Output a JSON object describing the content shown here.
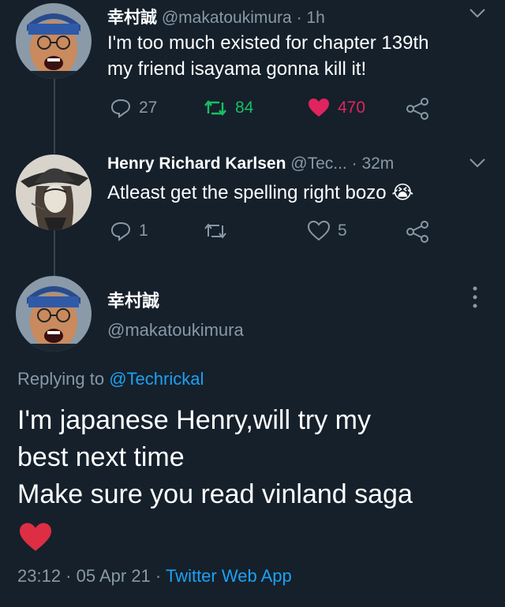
{
  "tweet1": {
    "display_name": "幸村誠",
    "handle": "@makatoukimura",
    "time": "· 1h",
    "text_line1": "I'm too much existed for chapter 139th",
    "text_line2": "my friend isayama gonna kill it!",
    "replies": "27",
    "retweets": "84",
    "likes": "470"
  },
  "tweet2": {
    "display_name": "Henry Richard Karlsen",
    "handle": "@Tec...",
    "time": "· 32m",
    "text": "Atleast get the spelling right bozo",
    "emoji": "😭",
    "replies": "1",
    "likes": "5"
  },
  "main_tweet": {
    "display_name": "幸村誠",
    "handle": "@makatoukimura",
    "replying_prefix": "Replying to",
    "replying_to": "@Techrickal",
    "text_line1": "I'm japanese Henry,will try my",
    "text_line2": "best next time",
    "text_line3": "Make sure you read vinland saga",
    "heart_emoji": "❤️",
    "timestamp": "23:12 · 05 Apr 21 ·",
    "source": "Twitter Web App"
  },
  "colors": {
    "background": "#15202b",
    "link": "#1da1f2",
    "muted": "#8899a6",
    "retweet_green": "#17bf63",
    "like_pink": "#e0245e"
  },
  "icons": [
    "chevron-down-icon",
    "reply-icon",
    "retweet-icon",
    "heart-icon",
    "share-icon",
    "more-vertical-icon"
  ]
}
